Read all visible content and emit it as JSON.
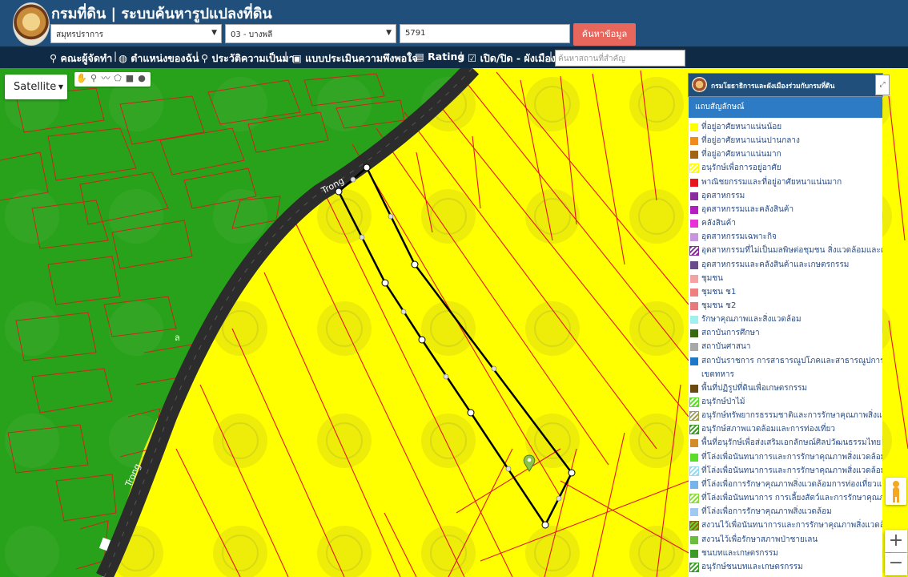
{
  "header": {
    "title": "กรมที่ดิน | ระบบค้นหารูปแปลงที่ดิน",
    "province": "สมุทรปราการ",
    "district": "03 - บางพลี",
    "parcel_number": "5791",
    "search_button": "ค้นหาข้อมูล"
  },
  "toolbar": {
    "items": [
      "คณะผู้จัดทำ",
      "ตำแหน่งของฉัน",
      "ประวัติความเป็นมา",
      "แบบประเมินความพึงพอใจ",
      "Rating",
      "เปิด/ปิด - ผังเมือง"
    ],
    "place_search_placeholder": "ค้นหาสถานที่สำคัญ"
  },
  "map": {
    "map_type": "Satellite",
    "road_label": "Trong",
    "road_label_2": "Trong",
    "road_fragment": "ล",
    "colors": {
      "green_zone": "#27a21a",
      "yellow_zone": "#ffff00",
      "parcel_lines": "#e4161b",
      "road": "#2c2c2c",
      "selected_parcel": "#000000"
    }
  },
  "legend": {
    "header_title": "กรมโยธาธิการและผังเมืองร่วมกับกรมที่ดิน",
    "subtitle": "แถบสัญลักษณ์",
    "items": [
      {
        "label": "ที่อยู่อาศัยหนาแน่นน้อย",
        "color": "#ffff00"
      },
      {
        "label": "ที่อยู่อาศัยหนาแน่นปานกลาง",
        "color": "#f08c1e"
      },
      {
        "label": "ที่อยู่อาศัยหนาแน่นมาก",
        "color": "#a06414"
      },
      {
        "label": "อนุรักษ์เพื่อการอยู่อาศัย",
        "color": "hatch-yellow"
      },
      {
        "label": "พาณิชยกรรมและที่อยู่อาศัยหนาแน่นมาก",
        "color": "#e8151c"
      },
      {
        "label": "อุตสาหกรรม",
        "color": "#8a2ba0"
      },
      {
        "label": "อุตสาหกรรมและคลังสินค้า",
        "color": "#b41ebe"
      },
      {
        "label": "คลังสินค้า",
        "color": "#e632d7"
      },
      {
        "label": "อุตสาหกรรมเฉพาะกิจ",
        "color": "#c896dc"
      },
      {
        "label": "อุตสาหกรรมที่ไม่เป็นมลพิษต่อชุมชน สิ่งแวดล้อมและคลังสินค้า",
        "color": "hatch-purple"
      },
      {
        "label": "อุตสาหกรรมและคลังสินค้าและเกษตรกรรม",
        "color": "#6a4a8a"
      },
      {
        "label": "ชุมชน",
        "color": "#f4a3a3"
      },
      {
        "label": "ชุมชน ช1",
        "color": "#f08080"
      },
      {
        "label": "ชุมชน ช2",
        "color": "#e77b7b"
      },
      {
        "label": "รักษาคุณภาพและสิ่งแวดล้อม",
        "color": "#a0f0f0"
      },
      {
        "label": "สถาบันการศึกษา",
        "color": "#3a6a10"
      },
      {
        "label": "สถาบันศาสนา",
        "color": "#a8a8a8"
      },
      {
        "label": "สถาบันราชการ การสาธารณูปโภคและสาธารณูปการ",
        "color": "#1e78c8"
      },
      {
        "label": "เขตทหาร",
        "color": "none"
      },
      {
        "label": "พื้นที่ปฏิรูปที่ดินเพื่อเกษตรกรรม",
        "color": "#6a4a10"
      },
      {
        "label": "อนุรักษ์ป่าไม้",
        "color": "hatch-green"
      },
      {
        "label": "อนุรักษ์ทรัพยากรธรรมชาติและการรักษาคุณภาพสิ่งแวดล้อม",
        "color": "hatch-olive"
      },
      {
        "label": "อนุรักษ์สภาพแวดล้อมและการท่องเที่ยว",
        "color": "hatch-green2"
      },
      {
        "label": "พื้นที่อนุรักษ์เพื่อส่งเสริมเอกลักษณ์ศิลปวัฒนธรรมไทย",
        "color": "#d28c28"
      },
      {
        "label": "ที่โล่งเพื่อนันทนาการและการรักษาคุณภาพสิ่งแวดล้อม",
        "color": "#5adc28"
      },
      {
        "label": "ที่โล่งเพื่อนันทนาการและการรักษาคุณภาพสิ่งแวดล้อมชายฝั่งทะเล",
        "color": "hatch-cyan"
      },
      {
        "label": "ที่โล่งเพื่อการรักษาคุณภาพสิ่งแวดล้อมการท่องเที่ยวและการประมง",
        "color": "#78b4e6"
      },
      {
        "label": "ที่โล่งเพื่อนันทนาการ การเลี้ยงสัตว์และการรักษาคุณภาพสิ่งแวดล้อม",
        "color": "hatch-lime"
      },
      {
        "label": "ที่โล่งเพื่อการรักษาคุณภาพสิ่งแวดล้อม",
        "color": "#a0c8f0"
      },
      {
        "label": "สงวนไว้เพื่อนันทนาการและการรักษาคุณภาพสิ่งแวดล้อม",
        "color": "hatch-brown"
      },
      {
        "label": "สงวนไว้เพื่อรักษาสภาพป่าชายเลน",
        "color": "#6abe3c"
      },
      {
        "label": "ชนบทและเกษตรกรรม",
        "color": "#3c9a28"
      },
      {
        "label": "อนุรักษ์ชนบทและเกษตรกรรม",
        "color": "hatch-green3"
      }
    ]
  }
}
